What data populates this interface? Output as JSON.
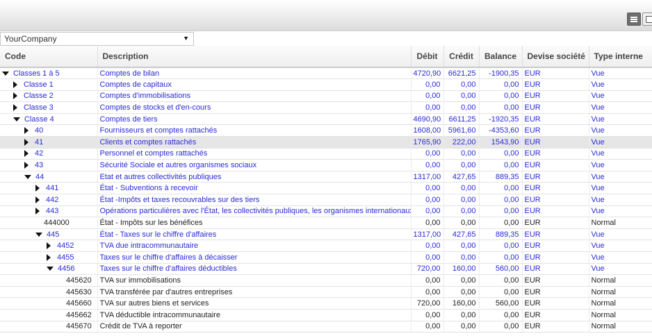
{
  "company": {
    "selected": "YourCompany"
  },
  "columns": {
    "code": "Code",
    "description": "Description",
    "debit": "Débit",
    "credit": "Crédit",
    "balance": "Balance",
    "currency": "Devise société",
    "type": "Type interne"
  },
  "rows": [
    {
      "code": "Classes 1 à 5",
      "description": "Comptes de bilan",
      "debit": "4720,90",
      "credit": "6621,25",
      "balance": "-1900,35",
      "currency": "EUR",
      "type": "Vue",
      "level": 0,
      "toggle": "expanded"
    },
    {
      "code": "Classe 1",
      "description": "Comptes de capitaux",
      "debit": "0,00",
      "credit": "0,00",
      "balance": "0,00",
      "currency": "EUR",
      "type": "Vue",
      "level": 1,
      "toggle": "collapsed"
    },
    {
      "code": "Classe 2",
      "description": "Comptes d'immobilisations",
      "debit": "0,00",
      "credit": "0,00",
      "balance": "0,00",
      "currency": "EUR",
      "type": "Vue",
      "level": 1,
      "toggle": "collapsed"
    },
    {
      "code": "Classe 3",
      "description": "Comptes de stocks et d'en-cours",
      "debit": "0,00",
      "credit": "0,00",
      "balance": "0,00",
      "currency": "EUR",
      "type": "Vue",
      "level": 1,
      "toggle": "collapsed"
    },
    {
      "code": "Classe 4",
      "description": "Comptes de tiers",
      "debit": "4690,90",
      "credit": "6611,25",
      "balance": "-1920,35",
      "currency": "EUR",
      "type": "Vue",
      "level": 1,
      "toggle": "expanded"
    },
    {
      "code": "40",
      "description": "Fournisseurs et comptes rattachés",
      "debit": "1608,00",
      "credit": "5961,60",
      "balance": "-4353,60",
      "currency": "EUR",
      "type": "Vue",
      "level": 2,
      "toggle": "collapsed"
    },
    {
      "code": "41",
      "description": "Clients et comptes rattachés",
      "debit": "1765,90",
      "credit": "222,00",
      "balance": "1543,90",
      "currency": "EUR",
      "type": "Vue",
      "level": 2,
      "toggle": "collapsed",
      "selected": true
    },
    {
      "code": "42",
      "description": "Personnel et comptes rattachés",
      "debit": "0,00",
      "credit": "0,00",
      "balance": "0,00",
      "currency": "EUR",
      "type": "Vue",
      "level": 2,
      "toggle": "collapsed"
    },
    {
      "code": "43",
      "description": "Sécurité Sociale et autres organismes sociaux",
      "debit": "0,00",
      "credit": "0,00",
      "balance": "0,00",
      "currency": "EUR",
      "type": "Vue",
      "level": 2,
      "toggle": "collapsed"
    },
    {
      "code": "44",
      "description": "Etat et autres collectivités publiques",
      "debit": "1317,00",
      "credit": "427,65",
      "balance": "889,35",
      "currency": "EUR",
      "type": "Vue",
      "level": 2,
      "toggle": "expanded"
    },
    {
      "code": "441",
      "description": "État - Subventions à recevoir",
      "debit": "0,00",
      "credit": "0,00",
      "balance": "0,00",
      "currency": "EUR",
      "type": "Vue",
      "level": 3,
      "toggle": "collapsed"
    },
    {
      "code": "442",
      "description": "État -Impôts et taxes recouvrables sur des tiers",
      "debit": "0,00",
      "credit": "0,00",
      "balance": "0,00",
      "currency": "EUR",
      "type": "Vue",
      "level": 3,
      "toggle": "collapsed"
    },
    {
      "code": "443",
      "description": "Opérations particulières avec l'État, les collectivités publiques, les organismes internationaux",
      "debit": "0,00",
      "credit": "0,00",
      "balance": "0,00",
      "currency": "EUR",
      "type": "Vue",
      "level": 3,
      "toggle": "collapsed"
    },
    {
      "code": "444000",
      "description": "État - Impôts sur les bénéfices",
      "debit": "0,00",
      "credit": "0,00",
      "balance": "0,00",
      "currency": "EUR",
      "type": "Normal",
      "level": 3,
      "toggle": "none"
    },
    {
      "code": "445",
      "description": "État - Taxes sur le chiffre d'affaires",
      "debit": "1317,00",
      "credit": "427,65",
      "balance": "889,35",
      "currency": "EUR",
      "type": "Vue",
      "level": 3,
      "toggle": "expanded"
    },
    {
      "code": "4452",
      "description": "TVA due intracommunautaire",
      "debit": "0,00",
      "credit": "0,00",
      "balance": "0,00",
      "currency": "EUR",
      "type": "Vue",
      "level": 4,
      "toggle": "collapsed"
    },
    {
      "code": "4455",
      "description": "Taxes sur le chiffre d'affaires à décaisser",
      "debit": "0,00",
      "credit": "0,00",
      "balance": "0,00",
      "currency": "EUR",
      "type": "Vue",
      "level": 4,
      "toggle": "collapsed"
    },
    {
      "code": "4456",
      "description": "Taxes sur le chiffre d'affaires déductibles",
      "debit": "720,00",
      "credit": "160,00",
      "balance": "560,00",
      "currency": "EUR",
      "type": "Vue",
      "level": 4,
      "toggle": "expanded"
    },
    {
      "code": "445620",
      "description": "TVA sur immobilisations",
      "debit": "0,00",
      "credit": "0,00",
      "balance": "0,00",
      "currency": "EUR",
      "type": "Normal",
      "level": 5,
      "toggle": "none"
    },
    {
      "code": "445630",
      "description": "TVA transférée par d'autres entreprises",
      "debit": "0,00",
      "credit": "0,00",
      "balance": "0,00",
      "currency": "EUR",
      "type": "Normal",
      "level": 5,
      "toggle": "none"
    },
    {
      "code": "445660",
      "description": "TVA sur autres biens et services",
      "debit": "720,00",
      "credit": "160,00",
      "balance": "560,00",
      "currency": "EUR",
      "type": "Normal",
      "level": 5,
      "toggle": "none"
    },
    {
      "code": "445662",
      "description": "TVA déductible intracommunautaire",
      "debit": "0,00",
      "credit": "0,00",
      "balance": "0,00",
      "currency": "EUR",
      "type": "Normal",
      "level": 5,
      "toggle": "none"
    },
    {
      "code": "445670",
      "description": "Crédit de TVA à reporter",
      "debit": "0,00",
      "credit": "0,00",
      "balance": "0,00",
      "currency": "EUR",
      "type": "Normal",
      "level": 5,
      "toggle": "none"
    }
  ]
}
